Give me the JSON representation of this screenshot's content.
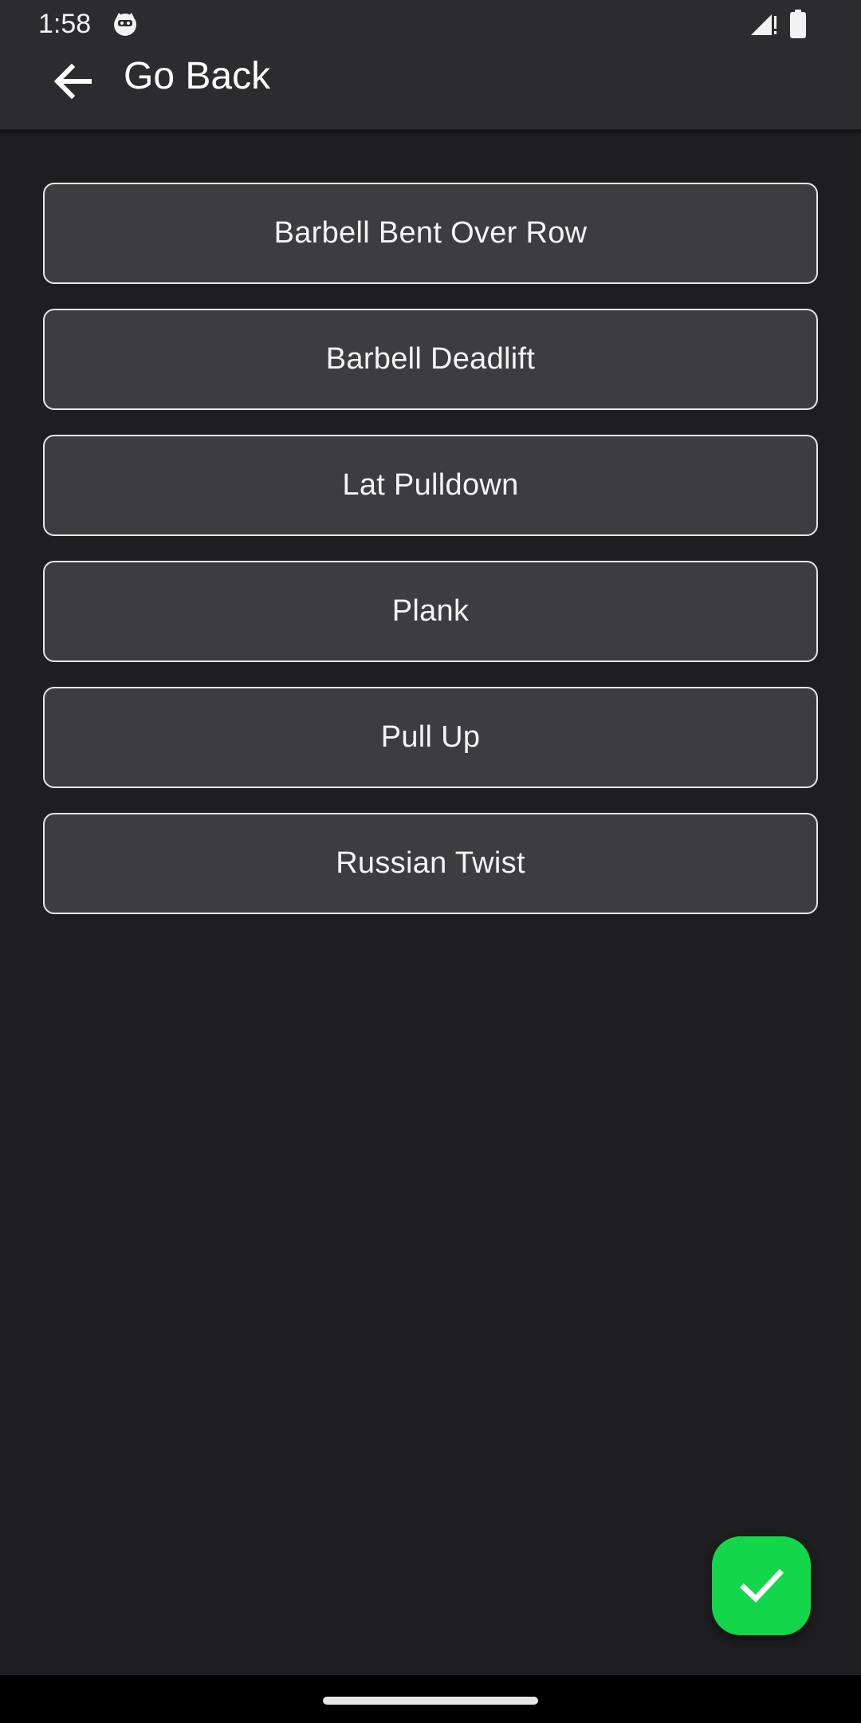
{
  "status_bar": {
    "time": "1:58",
    "app_icon": "cat-face-icon",
    "signal_icon": "cellular-signal-icon",
    "battery_icon": "battery-full-icon"
  },
  "header": {
    "back_icon": "arrow-left-icon",
    "title": "Go Back"
  },
  "exercises": [
    {
      "label": "Barbell Bent Over Row"
    },
    {
      "label": "Barbell Deadlift"
    },
    {
      "label": "Lat Pulldown"
    },
    {
      "label": "Plank"
    },
    {
      "label": "Pull Up"
    },
    {
      "label": "Russian Twist"
    }
  ],
  "fab": {
    "icon": "checkmark-icon",
    "color": "#13d64a"
  },
  "colors": {
    "background": "#1e1e20",
    "top_bar": "#2c2c2e",
    "item_background": "#3d3d40",
    "item_border": "#e6e6e6"
  }
}
